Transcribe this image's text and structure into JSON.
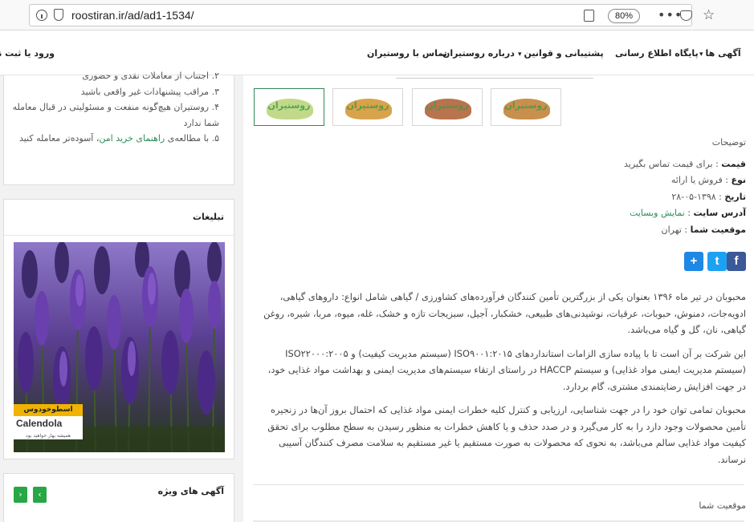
{
  "browser": {
    "url": "roostiran.ir/ad/ad1-1534/",
    "zoom": "80%"
  },
  "nav": {
    "ads": "آگهی ها",
    "info_base": "پایگاه اطلاع رسانی",
    "support": "پشتیبانی و قوانین",
    "about": "درباره روستیران",
    "contact": "تماس با روستیران",
    "login": "ورود یا ثبت نام"
  },
  "tips": {
    "item1": "۲. اجتناب از معاملات نقدی و حضوری",
    "item2": "۳. مراقب پیشنهادات غیر واقعی باشید",
    "item3": "۴. روستیران هیچ‌گونه منفعت و مسئولیتی در قبال معامله شما ندارد",
    "item4_prefix": "۵. با مطالعه‌ی",
    "item4_link": "راهنمای خرید امن",
    "item4_suffix": "، آسوده‌تر معامله کنید"
  },
  "ads": {
    "title": "تبلیغات",
    "banner_tag": "اسطوخودوس",
    "banner_brand": "Calendola",
    "banner_slogan": "همیشه بهار خواهید بود"
  },
  "featured": {
    "title": "آگهی های ویژه",
    "prev": "‹",
    "next": "›"
  },
  "gallery": {
    "logo_text": "روستیران",
    "colors": [
      "#c2d98a",
      "#d8a34a",
      "#b9734d",
      "#c98f4d"
    ]
  },
  "details": {
    "section_title": "توضیحات",
    "price_label": "قیمت",
    "price_value": "برای قیمت تماس بگیرید",
    "type_label": "نوع",
    "type_value": "فروش یا ارائه",
    "date_label": "تاریخ",
    "date_value": "۱۳۹۸-۰۵-۲۸",
    "site_label": "آدرس سایت",
    "site_value": "نمایش وبسایت",
    "location_label": "موقعیت شما",
    "location_value": "تهران"
  },
  "share": {
    "addthis": "+",
    "twitter": "t",
    "facebook": "f",
    "addthis_color": "#1e88e5",
    "twitter_color": "#1da1f2",
    "facebook_color": "#3b5998"
  },
  "description": {
    "p1": "محبوبان در تیر ماه ۱۳۹۶ بعنوان یکی از بزرگترین تأمین کنندگان فرآورده‌های کشاورزی / گیاهی شامل انواع: داروهای گیاهی، ادویه‌جات، دمنوش، حبوبات، عرقیات، نوشیدنی‌های طبیعی، خشکبار، آجیل، سبزیجات تازه و خشک، غله، میوه، مربا، شیره، روغن گیاهی، نان، گل و گیاه می‌باشد.",
    "p2": "این شرکت بر آن است تا با پیاده سازی الزامات استانداردهای ISO۹۰۰۱:۲۰۱۵ (سیستم مدیریت کیفیت) و ISO۲۲۰۰۰:۲۰۰۵ (سیستم مدیریت ایمنی مواد غذایی) و سیستم HACCP در راستای ارتقاء سیستم‌های مدیریت ایمنی و بهداشت مواد غذایی خود، در جهت افزایش رضایتمندی مشتری، گام بردارد.",
    "p3": "محبوبان تمامی توان خود را در جهت شناسایی، ارزیابی و کنترل کلیه خطرات ایمنی مواد غذایی که احتمال بروز آن‌ها در زنجیره تأمین محصولات وجود دارد را به کار می‌گیرد و در صدد حذف و یا کاهش خطرات به منظور رسیدن به سطح مطلوب برای تحقق کیفیت مواد غذایی سالم می‌باشد، به نحوی که محصولات به صورت مستقیم یا غیر مستقیم به سلامت مصرف کنندگان آسیبی نرساند."
  },
  "location": {
    "title": "موقعیت شما"
  }
}
